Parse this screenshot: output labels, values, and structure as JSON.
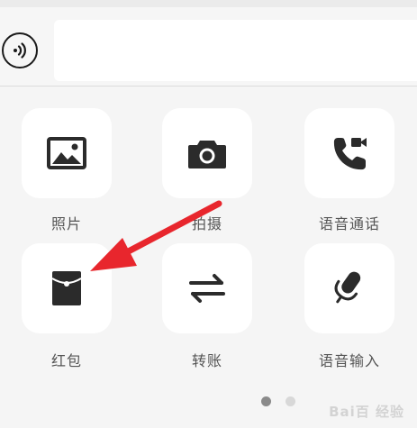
{
  "panel": {
    "items": [
      {
        "label": "照片",
        "icon": "image-icon"
      },
      {
        "label": "拍摄",
        "icon": "camera-icon"
      },
      {
        "label": "语音通话",
        "icon": "call-video-icon"
      },
      {
        "label": "红包",
        "icon": "red-packet-icon"
      },
      {
        "label": "转账",
        "icon": "transfer-icon"
      },
      {
        "label": "语音输入",
        "icon": "microphone-icon"
      }
    ],
    "page_indicator": {
      "current": 1,
      "total": 2
    }
  },
  "watermark": {
    "text": "Bai百 经验"
  },
  "colors": {
    "icon": "#2b2b2b",
    "tile_bg": "#ffffff",
    "panel_bg": "#f5f5f5",
    "arrow": "#e8262d",
    "dot_active": "#8a8a8a",
    "dot_inactive": "#d8d8d8"
  }
}
